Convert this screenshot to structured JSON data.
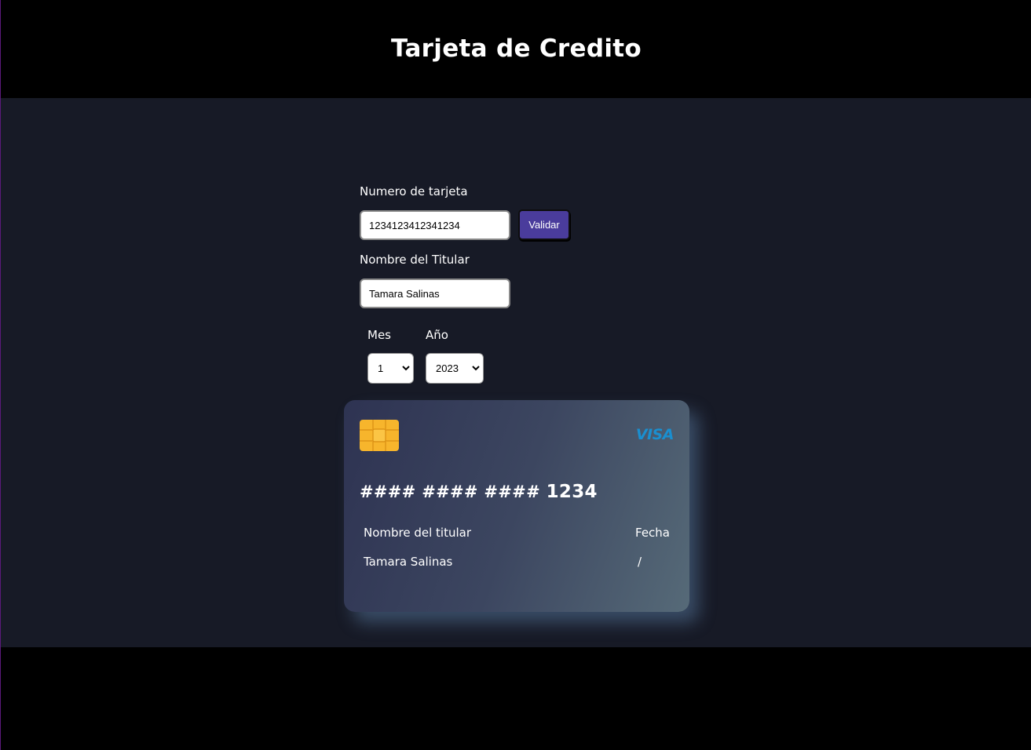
{
  "header": {
    "title": "Tarjeta de Credito"
  },
  "form": {
    "card_number_label": "Numero de tarjeta",
    "card_number_value": "1234123412341234",
    "validate_label": "Validar",
    "holder_label": "Nombre del Titular",
    "holder_value": "Tamara Salinas",
    "month_label": "Mes",
    "month_value": "1",
    "year_label": "Año",
    "year_value": "2023"
  },
  "card": {
    "brand": "VISA",
    "masked_number": "#### #### ####",
    "last_digits": "1234",
    "holder_heading": "Nombre del titular",
    "holder_name": "Tamara Salinas",
    "date_heading": "Fecha",
    "date_value": "/"
  },
  "colors": {
    "page_background": "#000000",
    "main_background": "#171a26",
    "button_background": "#4a3c9c",
    "chip": "#f7b52c",
    "visa_blue": "#1a8fd0",
    "visa_accent": "#f0a81c"
  },
  "icons": {
    "chip": "card-chip-icon",
    "select_chevron": "chevron-down-icon",
    "brand_logo": "visa-logo"
  }
}
